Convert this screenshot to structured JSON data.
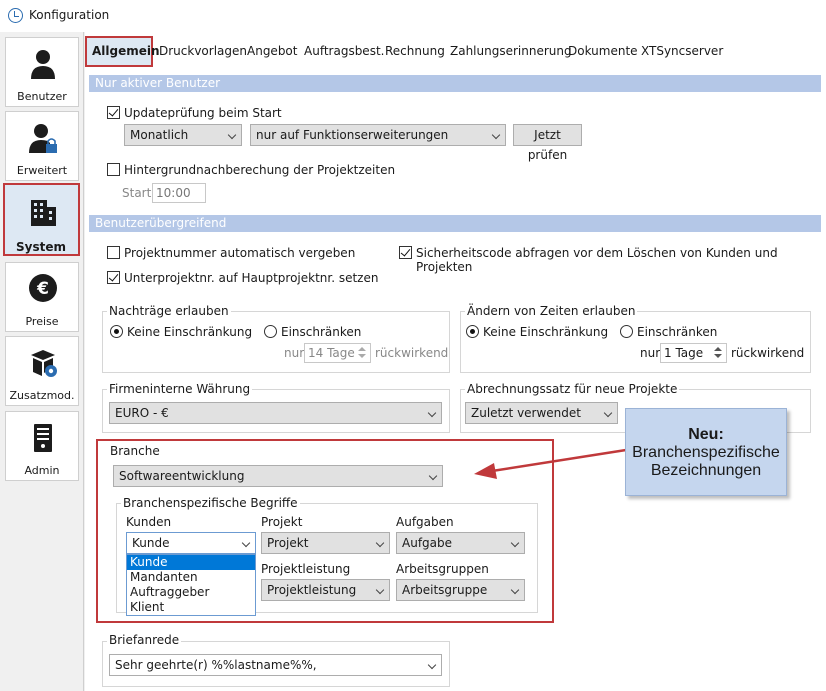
{
  "window": {
    "title": "Konfiguration"
  },
  "nav": {
    "items": [
      {
        "label": "Benutzer"
      },
      {
        "label": "Erweitert"
      },
      {
        "label": "System"
      },
      {
        "label": "Preise"
      },
      {
        "label": "Zusatzmod."
      },
      {
        "label": "Admin"
      }
    ]
  },
  "tabs": [
    "Allgemein",
    "Druckvorlagen",
    "Angebot",
    "Auftragsbest.",
    "Rechnung",
    "Zahlungserinnerung",
    "Dokumente",
    "XTSyncserver"
  ],
  "section1": {
    "title": "Nur aktiver Benutzer",
    "update_check_label": "Updateprüfung beim Start",
    "update_check_checked": true,
    "interval": "Monatlich",
    "scope": "nur auf Funktionserweiterungen",
    "check_now_button": "Jetzt prüfen",
    "background_recalc_label": "Hintergrundnachberechung der Projektzeiten",
    "background_recalc_checked": false,
    "start_label": "Start",
    "start_value": "10:00"
  },
  "section2": {
    "title": "Benutzerübergreifend",
    "auto_number_label": "Projektnummer automatisch vergeben",
    "auto_number_checked": false,
    "security_code_label": "Sicherheitscode abfragen vor dem Löschen von Kunden und Projekten",
    "security_code_checked": true,
    "subproject_label": "Unterprojektnr. auf Hauptprojektnr. setzen",
    "subproject_checked": true,
    "nachtraege": {
      "title": "Nachträge erlauben",
      "option1": "Keine Einschränkung",
      "option2": "Einschränken",
      "selected": "Keine Einschränkung",
      "prefix": "nur",
      "value": "14 Tage",
      "suffix": "rückwirkend"
    },
    "zeiten": {
      "title": "Ändern von Zeiten erlauben",
      "option1": "Keine Einschränkung",
      "option2": "Einschränken",
      "selected": "Keine Einschränkung",
      "prefix": "nur",
      "value": "1 Tage",
      "suffix": "rückwirkend"
    },
    "waehrung": {
      "title": "Firmeninterne Währung",
      "value": "EURO - €"
    },
    "abrechnung": {
      "title": "Abrechnungssatz für neue Projekte",
      "value": "Zuletzt verwendet"
    },
    "branche": {
      "title": "Branche",
      "value": "Softwareentwicklung",
      "begriffe_title": "Branchenspezifische Begriffe",
      "fields": [
        {
          "label": "Kunden",
          "value": "Kunde"
        },
        {
          "label": "Projekt",
          "value": "Projekt"
        },
        {
          "label": "Aufgaben",
          "value": "Aufgabe"
        },
        {
          "label": "Projektleistung",
          "value": "Projektleistung"
        },
        {
          "label": "Arbeitsgruppen",
          "value": "Arbeitsgruppe"
        }
      ],
      "kunden_options": [
        "Kunde",
        "Mandanten",
        "Auftraggeber",
        "Klient"
      ]
    },
    "briefanrede": {
      "title": "Briefanrede",
      "value": "Sehr geehrte(r) %%lastname%%,"
    }
  },
  "callout": {
    "title": "Neu:",
    "line1": "Branchenspezifische",
    "line2": "Bezeichnungen"
  },
  "colors": {
    "section_bar": "#b4c7e7",
    "highlight_red": "#c0393b",
    "dropdown_selection": "#0078d7",
    "callout_bg": "#c5d6ee"
  }
}
